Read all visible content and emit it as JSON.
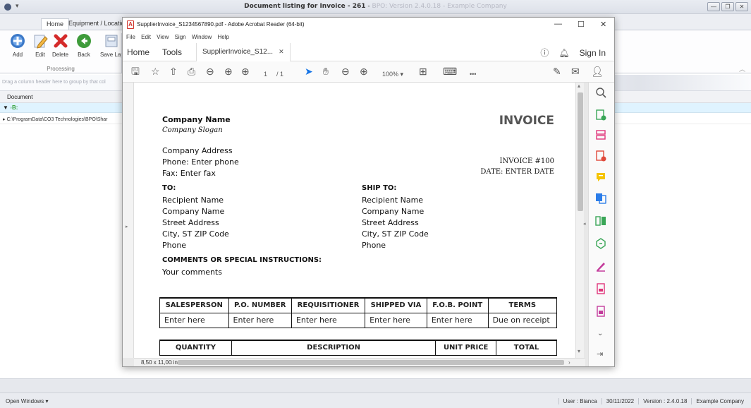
{
  "bpo": {
    "title_main": "Document listing for Invoice - 261",
    "title_sep": " - ",
    "title_version": "BPO: Version 2.4.0.18 - Example Company",
    "qat_glyph": "▾",
    "tabs": [
      {
        "label": "Home"
      },
      {
        "label": "Equipment / Locations"
      }
    ],
    "ribbon": {
      "buttons": [
        {
          "label": "Add"
        },
        {
          "label": "Edit"
        },
        {
          "label": "Delete"
        },
        {
          "label": "Back"
        },
        {
          "label": "Save Lay"
        }
      ],
      "group_label": "Processing"
    },
    "grid": {
      "group_hint": "Drag a column header here to group by that col",
      "column_header": "Document",
      "filter_row_arrow": "▼",
      "filter_row_icon": "◦B:",
      "data_row_arrow": "▸",
      "data_row_text": "C:\\ProgramData\\CO3 Technologies\\BPO\\Shar"
    },
    "status": {
      "open_windows": "Open Windows ▾",
      "user": "User : Bianca",
      "date": "30/11/2022",
      "version": "Version : 2.4.0.18",
      "company": "Example Company"
    }
  },
  "acrobat": {
    "title": "SupplierInvoice_S1234567890.pdf - Adobe Acrobat Reader (64-bit)",
    "menu": [
      "File",
      "Edit",
      "View",
      "Sign",
      "Window",
      "Help"
    ],
    "tabs": {
      "home": "Home",
      "tools": "Tools",
      "doc": "SupplierInvoice_S12...",
      "sign_in": "Sign In"
    },
    "toolbar": {
      "page_current": "1",
      "page_total": "/ 1",
      "zoom": "100%"
    },
    "page_dims": "8,50 x 11,00 in",
    "ellipsis": "•••",
    "colors": {
      "accent": "#1473e6",
      "tool_pink": "#e0347a",
      "tool_red": "#e04a3b",
      "tool_yellow": "#f5c400",
      "tool_green": "#3aa657",
      "tool_blue": "#2b7de9"
    }
  },
  "invoice": {
    "company_name": "Company Name",
    "company_slogan": "Company Slogan",
    "title": "INVOICE",
    "address": "Company Address",
    "phone": "Phone: Enter phone",
    "fax": "Fax: Enter fax",
    "invoice_no": "INVOICE #100",
    "date": "DATE: ENTER DATE",
    "to_label": "TO:",
    "ship_label": "SHIP TO:",
    "to": [
      "Recipient Name",
      "Company Name",
      "Street Address",
      "City, ST ZIP Code",
      "Phone"
    ],
    "ship": [
      "Recipient Name",
      "Company Name",
      "Street Address",
      "City, ST ZIP Code",
      "Phone"
    ],
    "comments_label": "COMMENTS OR SPECIAL INSTRUCTIONS:",
    "comments": "Your comments",
    "table1": {
      "headers": [
        "SALESPERSON",
        "P.O. NUMBER",
        "REQUISITIONER",
        "SHIPPED VIA",
        "F.O.B. POINT",
        "TERMS"
      ],
      "row": [
        "Enter here",
        "Enter here",
        "Enter here",
        "Enter here",
        "Enter here",
        "Due on receipt"
      ]
    },
    "table2": {
      "headers": [
        "QUANTITY",
        "DESCRIPTION",
        "UNIT PRICE",
        "TOTAL"
      ]
    }
  }
}
